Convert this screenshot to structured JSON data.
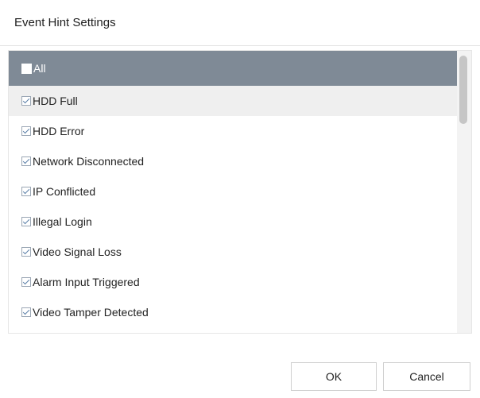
{
  "dialog": {
    "title": "Event Hint Settings",
    "all_label": "All",
    "items": [
      {
        "label": "HDD Full",
        "checked": true
      },
      {
        "label": "HDD Error",
        "checked": true
      },
      {
        "label": "Network Disconnected",
        "checked": true
      },
      {
        "label": "IP Conflicted",
        "checked": true
      },
      {
        "label": "Illegal Login",
        "checked": true
      },
      {
        "label": "Video Signal Loss",
        "checked": true
      },
      {
        "label": "Alarm Input Triggered",
        "checked": true
      },
      {
        "label": "Video Tamper Detected",
        "checked": true
      }
    ],
    "ok_label": "OK",
    "cancel_label": "Cancel"
  }
}
